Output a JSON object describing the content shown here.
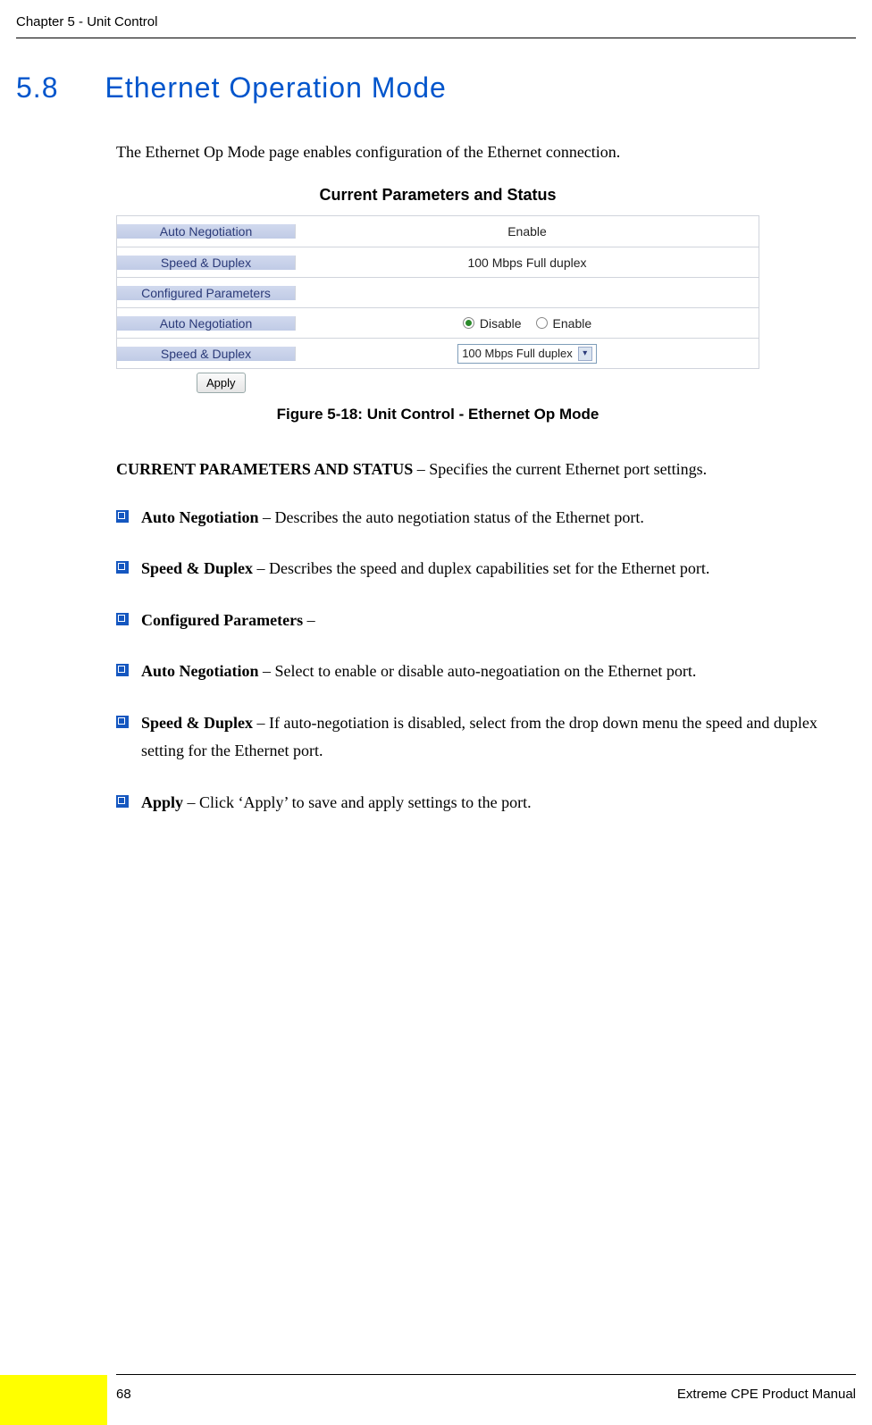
{
  "header": {
    "chapter": "Chapter 5 - Unit Control"
  },
  "section": {
    "number": "5.8",
    "title": "Ethernet Operation Mode"
  },
  "intro": "The Ethernet Op Mode page enables configuration of the Ethernet connection.",
  "figure": {
    "panel_title": "Current Parameters and Status",
    "rows": {
      "auto_neg_label": "Auto Negotiation",
      "auto_neg_value": "Enable",
      "speed_label": "Speed & Duplex",
      "speed_value": "100 Mbps Full duplex",
      "config_params_label": "Configured Parameters",
      "auto_neg2_label": "Auto Negotiation",
      "disable_label": "Disable",
      "enable_label": "Enable",
      "speed2_label": "Speed & Duplex",
      "speed_select_value": "100 Mbps Full duplex"
    },
    "apply_label": "Apply",
    "caption": "Figure 5-18: Unit Control - Ethernet Op Mode"
  },
  "body": {
    "para1_strong": "CURRENT PARAMETERS AND STATUS",
    "para1_rest": " – Specifies the current Ethernet port settings.",
    "items": [
      {
        "strong": "Auto Negotiation",
        "rest": " – Describes the auto negotiation status of the Ethernet port."
      },
      {
        "strong": "Speed & Duplex",
        "rest": " – Describes the speed and duplex capabilities set for the Ethernet port."
      },
      {
        "strong": "Configured Parameters",
        "rest": " –"
      },
      {
        "strong": "Auto Negotiation",
        "rest": " – Select to enable or disable auto-negoatiation on the Ethernet port."
      },
      {
        "strong": "Speed & Duplex",
        "rest": " – If auto-negotiation is disabled, select from the drop down menu the speed and duplex setting for the Ethernet port."
      },
      {
        "strong": "Apply",
        "rest": " – Click ‘Apply’ to save and apply settings to the port."
      }
    ]
  },
  "footer": {
    "page": "68",
    "manual": "Extreme CPE Product Manual"
  }
}
